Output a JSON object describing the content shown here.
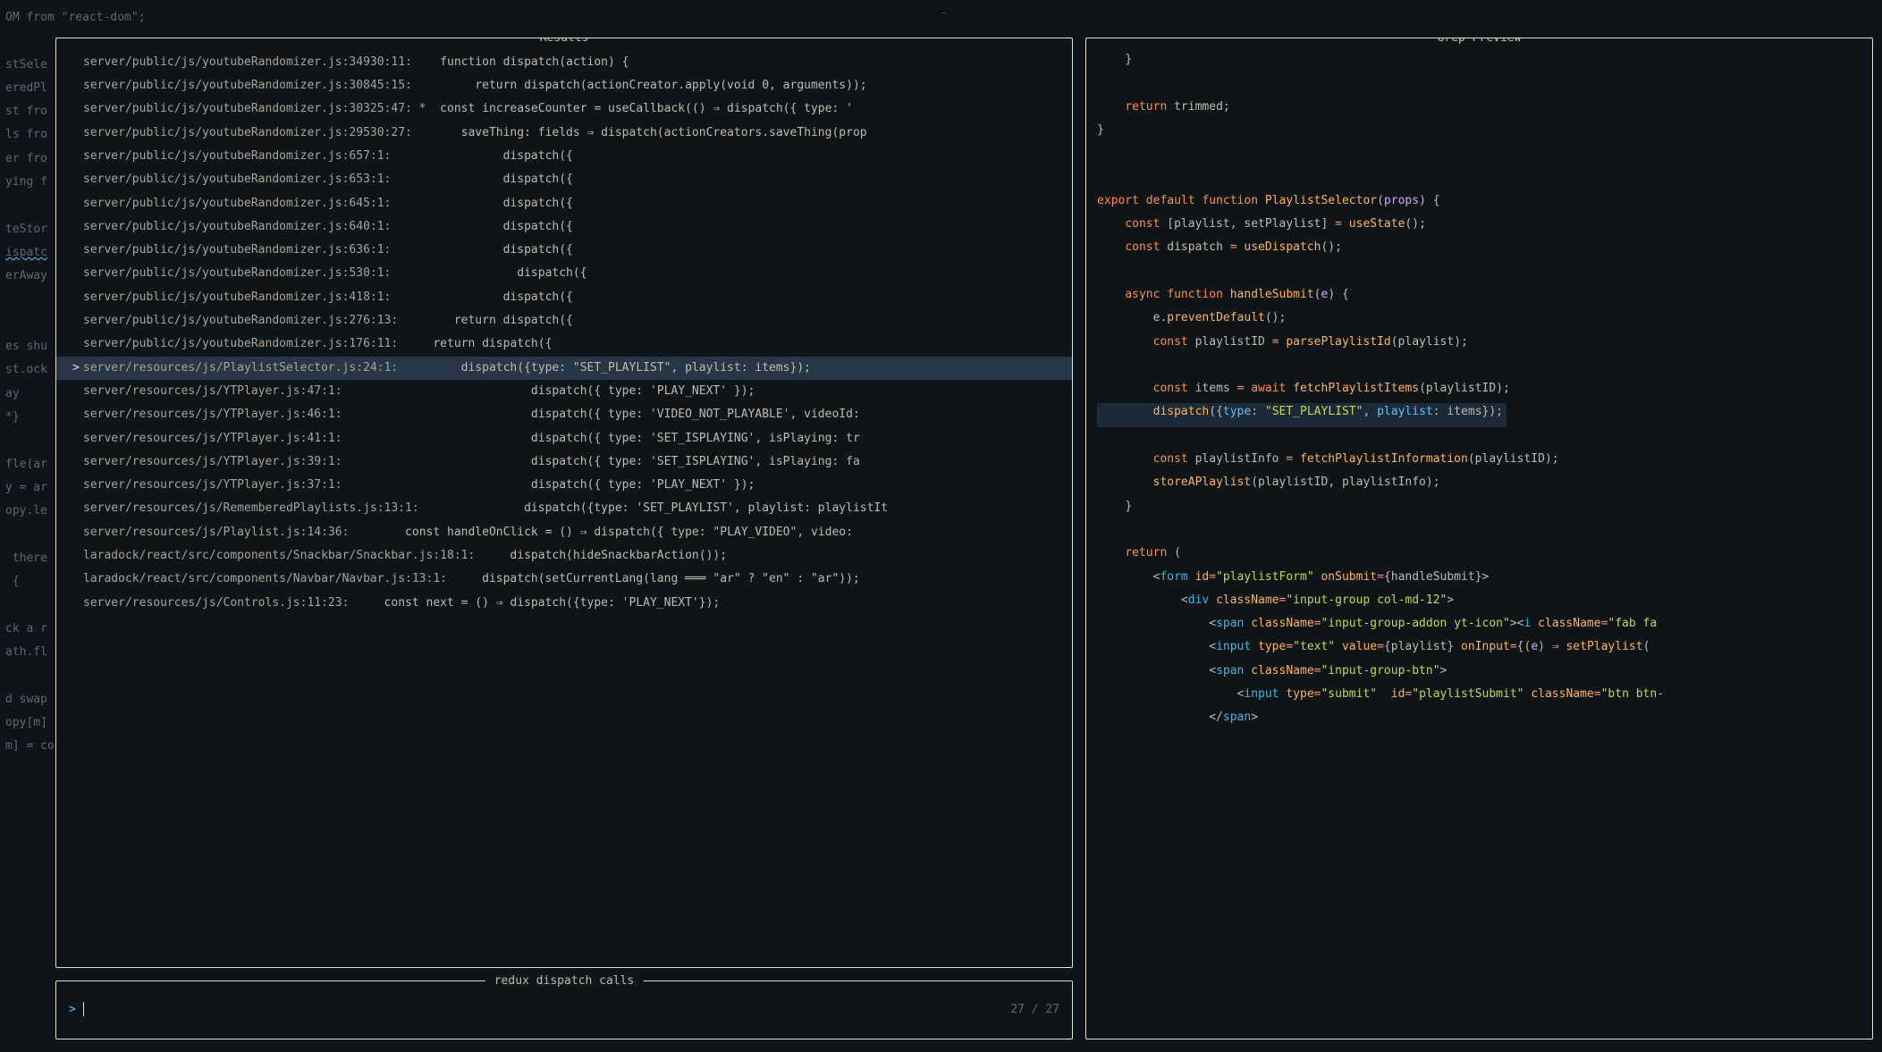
{
  "dividers": {
    "top": "~",
    "bottom": "~"
  },
  "bg_code": [
    {
      "cls": "",
      "text": "OM from \"react-dom\";"
    },
    {
      "cls": "",
      "text": ""
    },
    {
      "cls": "",
      "text": "stSele"
    },
    {
      "cls": "",
      "text": "eredPl"
    },
    {
      "cls": "",
      "text": "st fro"
    },
    {
      "cls": "",
      "text": "ls fro"
    },
    {
      "cls": "",
      "text": "er fro"
    },
    {
      "cls": "",
      "text": "ying f"
    },
    {
      "cls": "",
      "text": ""
    },
    {
      "cls": "",
      "text": "teStor"
    },
    {
      "cls": "wavy",
      "text": "ispatc"
    },
    {
      "cls": "",
      "text": "erAway"
    },
    {
      "cls": "",
      "text": ""
    },
    {
      "cls": "",
      "text": ""
    },
    {
      "cls": "",
      "text": "es shu"
    },
    {
      "cls": "",
      "text": "st.ock"
    },
    {
      "cls": "",
      "text": "ay"
    },
    {
      "cls": "",
      "text": "*}"
    },
    {
      "cls": "",
      "text": ""
    },
    {
      "cls": "",
      "text": "fle(ar"
    },
    {
      "cls": "",
      "text": "y = ar"
    },
    {
      "cls": "",
      "text": "opy.le"
    },
    {
      "cls": "",
      "text": ""
    },
    {
      "cls": "",
      "text": " there"
    },
    {
      "cls": "",
      "text": " {"
    },
    {
      "cls": "",
      "text": ""
    },
    {
      "cls": "",
      "text": "ck a r"
    },
    {
      "cls": "",
      "text": "ath.fl"
    },
    {
      "cls": "",
      "text": ""
    },
    {
      "cls": "",
      "text": "d swap"
    },
    {
      "cls": "",
      "text": "opy[m]"
    },
    {
      "cls": "",
      "text": "m] = copy[i];"
    }
  ],
  "results": {
    "title": "Results",
    "rows": [
      {
        "sel": false,
        "star": false,
        "loc": "server/public/js/youtubeRandomizer.js:34930:11:",
        "code": "  function dispatch(action) {"
      },
      {
        "sel": false,
        "star": false,
        "loc": "server/public/js/youtubeRandomizer.js:30845:15:",
        "code": "       return dispatch(actionCreator.apply(void 0, arguments));"
      },
      {
        "sel": false,
        "star": true,
        "loc": "server/public/js/youtubeRandomizer.js:30325:47:",
        "code": "  const increaseCounter = useCallback(() ⇒ dispatch({ type: '"
      },
      {
        "sel": false,
        "star": false,
        "loc": "server/public/js/youtubeRandomizer.js:29530:27:",
        "code": "     saveThing: fields ⇒ dispatch(actionCreators.saveThing(prop"
      },
      {
        "sel": false,
        "star": false,
        "loc": "server/public/js/youtubeRandomizer.js:657:1:",
        "code": "              dispatch({"
      },
      {
        "sel": false,
        "star": false,
        "loc": "server/public/js/youtubeRandomizer.js:653:1:",
        "code": "              dispatch({"
      },
      {
        "sel": false,
        "star": false,
        "loc": "server/public/js/youtubeRandomizer.js:645:1:",
        "code": "              dispatch({"
      },
      {
        "sel": false,
        "star": false,
        "loc": "server/public/js/youtubeRandomizer.js:640:1:",
        "code": "              dispatch({"
      },
      {
        "sel": false,
        "star": false,
        "loc": "server/public/js/youtubeRandomizer.js:636:1:",
        "code": "              dispatch({"
      },
      {
        "sel": false,
        "star": false,
        "loc": "server/public/js/youtubeRandomizer.js:530:1:",
        "code": "                dispatch({"
      },
      {
        "sel": false,
        "star": false,
        "loc": "server/public/js/youtubeRandomizer.js:418:1:",
        "code": "              dispatch({"
      },
      {
        "sel": false,
        "star": false,
        "loc": "server/public/js/youtubeRandomizer.js:276:13:",
        "code": "      return dispatch({"
      },
      {
        "sel": false,
        "star": false,
        "loc": "server/public/js/youtubeRandomizer.js:176:11:",
        "code": "   return dispatch({"
      },
      {
        "sel": true,
        "star": false,
        "loc": "server/resources/js/PlaylistSelector.js:24:1:",
        "code": "       dispatch({type: \"SET_PLAYLIST\", playlist: items});"
      },
      {
        "sel": false,
        "star": false,
        "loc": "server/resources/js/YTPlayer.js:47:1:",
        "code": "                         dispatch({ type: 'PLAY_NEXT' });"
      },
      {
        "sel": false,
        "star": false,
        "loc": "server/resources/js/YTPlayer.js:46:1:",
        "code": "                         dispatch({ type: 'VIDEO_NOT_PLAYABLE', videoId:"
      },
      {
        "sel": false,
        "star": false,
        "loc": "server/resources/js/YTPlayer.js:41:1:",
        "code": "                         dispatch({ type: 'SET_ISPLAYING', isPlaying: tr"
      },
      {
        "sel": false,
        "star": false,
        "loc": "server/resources/js/YTPlayer.js:39:1:",
        "code": "                         dispatch({ type: 'SET_ISPLAYING', isPlaying: fa"
      },
      {
        "sel": false,
        "star": false,
        "loc": "server/resources/js/YTPlayer.js:37:1:",
        "code": "                         dispatch({ type: 'PLAY_NEXT' });"
      },
      {
        "sel": false,
        "star": false,
        "loc": "server/resources/js/RememberedPlaylists.js:13:1:",
        "code": "             dispatch({type: 'SET_PLAYLIST', playlist: playlistIt"
      },
      {
        "sel": false,
        "star": false,
        "loc": "server/resources/js/Playlist.js:14:36:",
        "code": "      const handleOnClick = () ⇒ dispatch({ type: \"PLAY_VIDEO\", video:"
      },
      {
        "sel": false,
        "star": false,
        "loc": "laradock/react/src/components/Snackbar/Snackbar.js:18:1:",
        "code": "   dispatch(hideSnackbarAction());"
      },
      {
        "sel": false,
        "star": false,
        "loc": "laradock/react/src/components/Navbar/Navbar.js:13:1:",
        "code": "   dispatch(setCurrentLang(lang ═══ \"ar\" ? \"en\" : \"ar\"));"
      },
      {
        "sel": false,
        "star": false,
        "loc": "server/resources/js/Controls.js:11:23:",
        "code": "   const next = () ⇒ dispatch({type: 'PLAY_NEXT'});"
      }
    ]
  },
  "input": {
    "title": "redux dispatch calls",
    "prompt": ">",
    "value": "",
    "count": "27 / 27"
  },
  "preview": {
    "title": "Grep Preview",
    "lines": [
      {
        "hl": false,
        "html": "    <span class='p-punc'>}</span>"
      },
      {
        "hl": false,
        "html": ""
      },
      {
        "hl": false,
        "html": "    <span class='p-kw'>return</span> <span class='p-id'>trimmed</span><span class='p-punc'>;</span>"
      },
      {
        "hl": false,
        "html": "<span class='p-punc'>}</span>"
      },
      {
        "hl": false,
        "html": ""
      },
      {
        "hl": false,
        "html": ""
      },
      {
        "hl": false,
        "html": "<span class='p-kw'>export</span> <span class='p-kw'>default</span> <span class='p-kw'>function</span> <span class='p-fn'>PlaylistSelector</span><span class='p-punc'>(</span><span class='p-param'>props</span><span class='p-punc'>) {</span>"
      },
      {
        "hl": false,
        "html": "    <span class='p-kw'>const</span> <span class='p-punc'>[</span><span class='p-id'>playlist</span><span class='p-punc'>,</span> <span class='p-id'>setPlaylist</span><span class='p-punc'>]</span> <span class='p-op'>=</span> <span class='p-fn'>useState</span><span class='p-punc'>();</span>"
      },
      {
        "hl": false,
        "html": "    <span class='p-kw'>const</span> <span class='p-id'>dispatch</span> <span class='p-op'>=</span> <span class='p-fn'>useDispatch</span><span class='p-punc'>();</span>"
      },
      {
        "hl": false,
        "html": ""
      },
      {
        "hl": false,
        "html": "    <span class='p-kw'>async</span> <span class='p-kw'>function</span> <span class='p-fn'>handleSubmit</span><span class='p-punc'>(</span><span class='p-param'>e</span><span class='p-punc'>) {</span>"
      },
      {
        "hl": false,
        "html": "        <span class='p-id'>e</span><span class='p-punc'>.</span><span class='p-fn'>preventDefault</span><span class='p-punc'>();</span>"
      },
      {
        "hl": false,
        "html": "        <span class='p-kw'>const</span> <span class='p-id'>playlistID</span> <span class='p-op'>=</span> <span class='p-fn'>parsePlaylistId</span><span class='p-punc'>(</span><span class='p-id'>playlist</span><span class='p-punc'>);</span>"
      },
      {
        "hl": false,
        "html": ""
      },
      {
        "hl": false,
        "html": "        <span class='p-kw'>const</span> <span class='p-id'>items</span> <span class='p-op'>=</span> <span class='p-kw'>await</span> <span class='p-fn'>fetchPlaylistItems</span><span class='p-punc'>(</span><span class='p-id'>playlistID</span><span class='p-punc'>);</span>"
      },
      {
        "hl": true,
        "html": "        <span class='p-fn'>dispatch</span><span class='p-punc'>({</span><span class='p-prop'>type</span><span class='p-punc'>:</span> <span class='p-str'>\"SET_PLAYLIST\"</span><span class='p-punc'>,</span> <span class='p-prop'>playlist</span><span class='p-punc'>:</span> <span class='p-id'>items</span><span class='p-punc'>});</span>"
      },
      {
        "hl": false,
        "html": ""
      },
      {
        "hl": false,
        "html": "        <span class='p-kw'>const</span> <span class='p-id'>playlistInfo</span> <span class='p-op'>=</span> <span class='p-fn'>fetchPlaylistInformation</span><span class='p-punc'>(</span><span class='p-id'>playlistID</span><span class='p-punc'>);</span>"
      },
      {
        "hl": false,
        "html": "        <span class='p-fn'>storeAPlaylist</span><span class='p-punc'>(</span><span class='p-id'>playlistID</span><span class='p-punc'>,</span> <span class='p-id'>playlistInfo</span><span class='p-punc'>);</span>"
      },
      {
        "hl": false,
        "html": "    <span class='p-punc'>}</span>"
      },
      {
        "hl": false,
        "html": ""
      },
      {
        "hl": false,
        "html": "    <span class='p-kw'>return</span> <span class='p-punc'>(</span>"
      },
      {
        "hl": false,
        "html": "        <span class='p-punc'>&lt;</span><span class='p-tag'>form</span> <span class='p-attr'>id</span><span class='p-op'>=</span><span class='p-str'>\"playlistForm\"</span> <span class='p-attr'>onSubmit</span><span class='p-op'>=</span><span class='p-punc'>{</span><span class='p-id'>handleSubmit</span><span class='p-punc'>}&gt;</span>"
      },
      {
        "hl": false,
        "html": "            <span class='p-punc'>&lt;</span><span class='p-tag'>div</span> <span class='p-attr'>className</span><span class='p-op'>=</span><span class='p-str'>\"input-group col-md-12\"</span><span class='p-punc'>&gt;</span>"
      },
      {
        "hl": false,
        "html": "                <span class='p-punc'>&lt;</span><span class='p-tag'>span</span> <span class='p-attr'>className</span><span class='p-op'>=</span><span class='p-str'>\"input-group-addon yt-icon\"</span><span class='p-punc'>&gt;&lt;</span><span class='p-tag'>i</span> <span class='p-attr'>className</span><span class='p-op'>=</span><span class='p-str'>\"fab fa</span>"
      },
      {
        "hl": false,
        "html": "                <span class='p-punc'>&lt;</span><span class='p-tag'>input</span> <span class='p-attr'>type</span><span class='p-op'>=</span><span class='p-str'>\"text\"</span> <span class='p-attr'>value</span><span class='p-op'>=</span><span class='p-punc'>{</span><span class='p-id'>playlist</span><span class='p-punc'>}</span> <span class='p-attr'>onInput</span><span class='p-op'>=</span><span class='p-punc'>{(</span><span class='p-param'>e</span><span class='p-punc'>)</span> <span class='p-op'>⇒</span> <span class='p-fn'>setPlaylist</span><span class='p-punc'>(</span>"
      },
      {
        "hl": false,
        "html": "                <span class='p-punc'>&lt;</span><span class='p-tag'>span</span> <span class='p-attr'>className</span><span class='p-op'>=</span><span class='p-str'>\"input-group-btn\"</span><span class='p-punc'>&gt;</span>"
      },
      {
        "hl": false,
        "html": "                    <span class='p-punc'>&lt;</span><span class='p-tag'>input</span> <span class='p-attr'>type</span><span class='p-op'>=</span><span class='p-str'>\"submit\"</span>  <span class='p-attr'>id</span><span class='p-op'>=</span><span class='p-str'>\"playlistSubmit\"</span> <span class='p-attr'>className</span><span class='p-op'>=</span><span class='p-str'>\"btn btn-</span>"
      },
      {
        "hl": false,
        "html": "                <span class='p-punc'>&lt;/</span><span class='p-tag'>span</span><span class='p-punc'>&gt;</span>"
      }
    ]
  }
}
